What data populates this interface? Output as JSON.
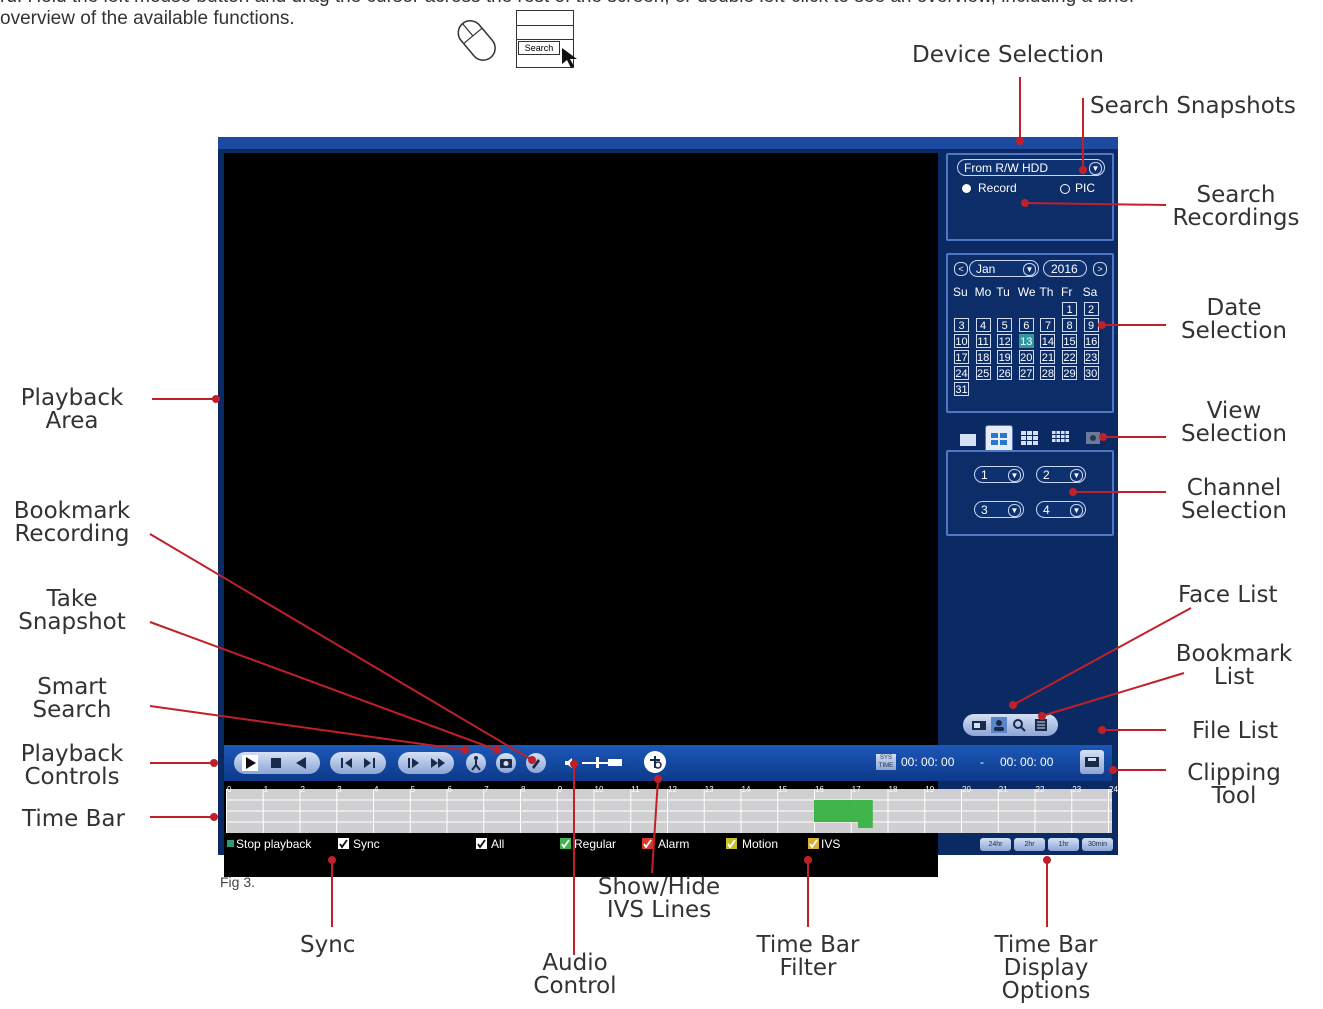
{
  "intro": {
    "line1": "rd. Hold the left mouse button and drag the cursor across the rest of the screen, or double left-click to see an overview, including a brief",
    "line2": "overview of the available functions."
  },
  "mouse_hint": {
    "search_label": "Search"
  },
  "callouts": {
    "device_selection": "Device Selection",
    "search_snapshots": "Search Snapshots",
    "search_recordings_1": "Search",
    "search_recordings_2": "Recordings",
    "date_selection_1": "Date",
    "date_selection_2": "Selection",
    "view_selection_1": "View",
    "view_selection_2": "Selection",
    "channel_selection_1": "Channel",
    "channel_selection_2": "Selection",
    "face_list": "Face List",
    "bookmark_list_1": "Bookmark",
    "bookmark_list_2": "List",
    "file_list": "File List",
    "clipping_tool_1": "Clipping",
    "clipping_tool_2": "Tool",
    "playback_area_1": "Playback",
    "playback_area_2": "Area",
    "bookmark_recording_1": "Bookmark",
    "bookmark_recording_2": "Recording",
    "take_snapshot_1": "Take",
    "take_snapshot_2": "Snapshot",
    "smart_search_1": "Smart",
    "smart_search_2": "Search",
    "playback_controls_1": "Playback",
    "playback_controls_2": "Controls",
    "time_bar": "Time Bar",
    "sync": "Sync",
    "audio_control_1": "Audio",
    "audio_control_2": "Control",
    "show_hide_ivs_1": "Show/Hide",
    "show_hide_ivs_2": "IVS Lines",
    "time_bar_filter_1": "Time Bar",
    "time_bar_filter_2": "Filter",
    "time_bar_display_1": "Time Bar",
    "time_bar_display_2": "Display",
    "time_bar_display_3": "Options"
  },
  "figure_label": "Fig 3.",
  "device": {
    "source": "From R/W HDD",
    "record_label": "Record",
    "pic_label": "PIC"
  },
  "calendar": {
    "month": "Jan",
    "year": "2016",
    "weekdays": [
      "Su",
      "Mo",
      "Tu",
      "We",
      "Th",
      "Fr",
      "Sa"
    ],
    "selected_day": "13",
    "days": [
      "1",
      "2",
      "3",
      "4",
      "5",
      "6",
      "7",
      "8",
      "9",
      "10",
      "11",
      "12",
      "13",
      "14",
      "15",
      "16",
      "17",
      "18",
      "19",
      "20",
      "21",
      "22",
      "23",
      "24",
      "25",
      "26",
      "27",
      "28",
      "29",
      "30",
      "31"
    ]
  },
  "channels": [
    "1",
    "2",
    "3",
    "4"
  ],
  "time": {
    "start": "00: 00: 00",
    "sep": "-",
    "end": "00: 00: 00"
  },
  "timebar": {
    "hours": [
      "0",
      "1",
      "2",
      "3",
      "4",
      "5",
      "6",
      "7",
      "8",
      "9",
      "10",
      "11",
      "12",
      "13",
      "14",
      "15",
      "16",
      "17",
      "18",
      "19",
      "20",
      "21",
      "22",
      "23",
      "24"
    ]
  },
  "filters": {
    "stop_playback": "Stop playback",
    "sync": "Sync",
    "all": "All",
    "regular": "Regular",
    "alarm": "Alarm",
    "motion": "Motion",
    "ivs": "IVS"
  },
  "zoom_options": [
    "24hr",
    "2hr",
    "1hr",
    "30min"
  ],
  "colors": {
    "callout_line": "#c0202a",
    "panel_bg": "#0b2a63",
    "regular": "#3fb44a",
    "alarm": "#d83a2a",
    "motion": "#c8c02a",
    "ivs": "#d8b030",
    "selected_day": "#2f9aa0"
  }
}
